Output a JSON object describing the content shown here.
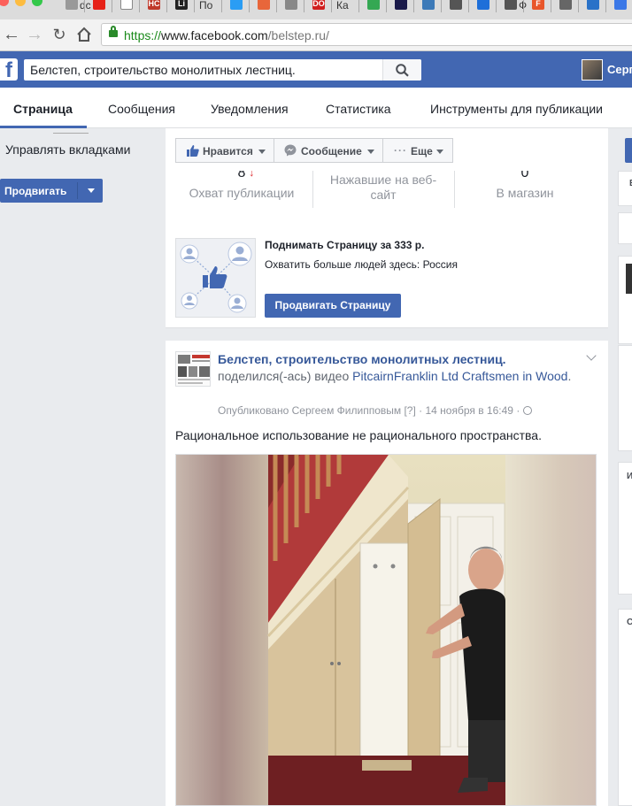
{
  "browser": {
    "tabs": [
      {
        "title": "dc",
        "icon": "document-favicon",
        "color": ""
      },
      {
        "title": "",
        "icon": "youtube-favicon",
        "color": "#e62117"
      },
      {
        "title": "",
        "icon": "blank-page-favicon",
        "color": "#ffffff"
      },
      {
        "title": "",
        "icon": "hc-favicon",
        "color": "#c0392b",
        "glyph": "HC"
      },
      {
        "title": "",
        "icon": "li-favicon",
        "color": "#222222",
        "glyph": "Li"
      },
      {
        "title": "По",
        "icon": "",
        "color": ""
      },
      {
        "title": "",
        "icon": "chat-favicon",
        "color": "#2a9df4"
      },
      {
        "title": "",
        "icon": "search-favicon",
        "color": "#e8663a"
      },
      {
        "title": "",
        "icon": "pen-favicon",
        "color": "#888888"
      },
      {
        "title": "",
        "icon": "do-favicon",
        "color": "#d11f1f",
        "glyph": "DO"
      },
      {
        "title": "Ка",
        "icon": "",
        "color": ""
      },
      {
        "title": "",
        "icon": "gplay-favicon",
        "color": "#34a853"
      },
      {
        "title": "",
        "icon": "x-favicon",
        "color": "#1a1a4a"
      },
      {
        "title": "",
        "icon": "chart-favicon",
        "color": "#3d7ab8"
      },
      {
        "title": "",
        "icon": "globe-favicon",
        "color": "#555555"
      },
      {
        "title": "",
        "icon": "x-blue-favicon",
        "color": "#1e6fd9"
      },
      {
        "title": "Ф",
        "icon": "globe-favicon",
        "color": "#555555"
      },
      {
        "title": "",
        "icon": "f-favicon",
        "color": "#e8562a",
        "glyph": "F"
      },
      {
        "title": "",
        "icon": "bulb-favicon",
        "color": "#666666"
      },
      {
        "title": "",
        "icon": "a-favicon",
        "color": "#2a72c8"
      },
      {
        "title": "",
        "icon": "doc-favicon",
        "color": "#3b78e7"
      }
    ],
    "url": {
      "scheme": "https://",
      "host": "www.facebook.com",
      "path": "/belstep.ru/"
    }
  },
  "fb": {
    "search_value": "Белстеп, строительство монолитных лестниц.",
    "profile_name": "Серг"
  },
  "pagenav": {
    "tabs": [
      "Страница",
      "Сообщения",
      "Уведомления",
      "Статистика",
      "Инструменты для публикации"
    ]
  },
  "left": {
    "manage_tabs": "Управлять вкладками",
    "promote": "Продвигать"
  },
  "actions": {
    "like": "Нравится",
    "message": "Сообщение",
    "more": "Еще"
  },
  "insights": {
    "stats": [
      {
        "value": "8",
        "label": "Охват публикации"
      },
      {
        "value": "",
        "label": "Нажавшие на веб-сайт"
      },
      {
        "value": "0",
        "label": "В магазин"
      }
    ],
    "boost_title": "Поднимать Страницу за 333 р.",
    "boost_sub": "Охватить больше людей здесь: Россия",
    "boost_button": "Продвигать Страницу"
  },
  "post": {
    "page_name": "Белстеп, строительство монолитных лестниц.",
    "shared_text": "поделился(-ась) видео",
    "shared_source": "PitcairnFranklin Ltd Craftsmen in Wood",
    "meta_prefix": "Опубликовано Сергеем Филипповым",
    "meta_help": "[?]",
    "meta_date": "14 ноября в 16:49",
    "text": "Рациональное использование не рационального пространства."
  },
  "right": {
    "letters": [
      "В",
      "И",
      "С"
    ]
  }
}
